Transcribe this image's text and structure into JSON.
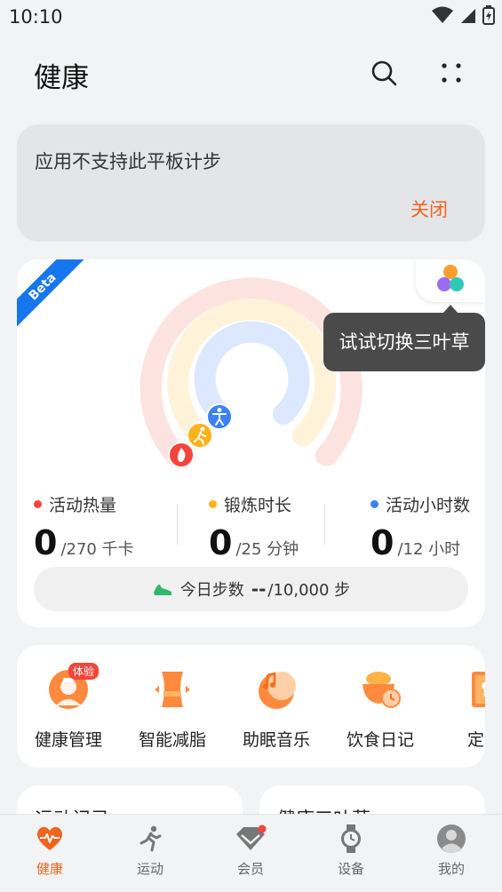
{
  "status_bar": {
    "time": "10:10"
  },
  "header": {
    "title": "健康"
  },
  "notice": {
    "message": "应用不支持此平板计步",
    "close_label": "关闭"
  },
  "rings_card": {
    "beta_label": "Beta",
    "tooltip": "试试切换三叶草",
    "colors": {
      "calories": "#f5443a",
      "exercise": "#ffb219",
      "activity": "#3c82f5"
    },
    "stats": [
      {
        "label": "活动热量",
        "value": "0",
        "unit": "/270 千卡"
      },
      {
        "label": "锻炼时长",
        "value": "0",
        "unit": "/25 分钟"
      },
      {
        "label": "活动小时数",
        "value": "0",
        "unit": "/12 小时"
      }
    ],
    "steps": {
      "label": "今日步数",
      "value": "--",
      "goal": "/10,000 步"
    }
  },
  "services": [
    {
      "label": "健康管理",
      "icon": "doctor-icon",
      "badge": "体验"
    },
    {
      "label": "智能减脂",
      "icon": "waist-icon"
    },
    {
      "label": "助眠音乐",
      "icon": "moon-music-icon"
    },
    {
      "label": "饮食日记",
      "icon": "food-bowl-icon"
    },
    {
      "label": "定制",
      "icon": "plan-book-icon"
    }
  ],
  "bottom_cards": {
    "card_a": "运动记录",
    "card_b": "健康三叶草"
  },
  "nav": [
    {
      "label": "健康",
      "icon": "heart-pulse-icon",
      "active": true
    },
    {
      "label": "运动",
      "icon": "runner-icon"
    },
    {
      "label": "会员",
      "icon": "diamond-icon"
    },
    {
      "label": "设备",
      "icon": "watch-icon"
    },
    {
      "label": "我的",
      "icon": "profile-icon"
    }
  ],
  "accent": "#f0641e"
}
